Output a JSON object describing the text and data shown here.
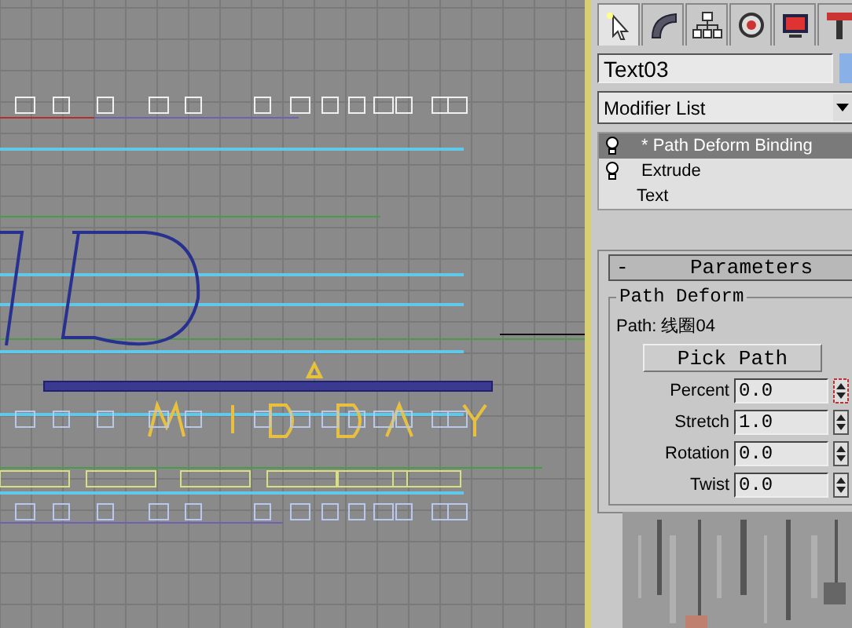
{
  "object_name": "Text03",
  "modifier_list": "Modifier List",
  "stack": [
    {
      "label": "* Path Deform Binding",
      "selected": true,
      "kind": "modifier"
    },
    {
      "label": "Extrude",
      "selected": false,
      "kind": "modifier"
    },
    {
      "label": "Text",
      "selected": false,
      "kind": "base"
    }
  ],
  "rollout": {
    "toggle": "-",
    "title": "Parameters",
    "group": "Path Deform",
    "path_label": "Path: 线圈04",
    "button": "Pick Path",
    "spinners": [
      {
        "label": "Percent",
        "value": "0.0",
        "active": true
      },
      {
        "label": "Stretch",
        "value": "1.0",
        "active": false
      },
      {
        "label": "Rotation",
        "value": "0.0",
        "active": false
      },
      {
        "label": "Twist",
        "value": "0.0",
        "active": false
      }
    ]
  }
}
